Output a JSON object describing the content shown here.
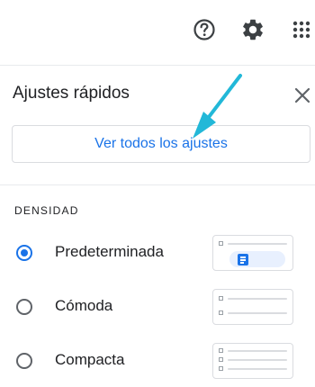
{
  "toolbar": {
    "help_icon": "help-circle-icon",
    "settings_icon": "gear-icon",
    "apps_icon": "apps-grid-icon"
  },
  "panel": {
    "title": "Ajustes rápidos",
    "close_icon": "close-icon",
    "see_all_button": "Ver todos los ajustes"
  },
  "density": {
    "section_label": "DENSIDAD",
    "options": [
      {
        "label": "Predeterminada",
        "selected": true
      },
      {
        "label": "Cómoda",
        "selected": false
      },
      {
        "label": "Compacta",
        "selected": false
      }
    ]
  },
  "colors": {
    "accent": "#1a73e8",
    "annotation_arrow": "#22b8d8"
  }
}
